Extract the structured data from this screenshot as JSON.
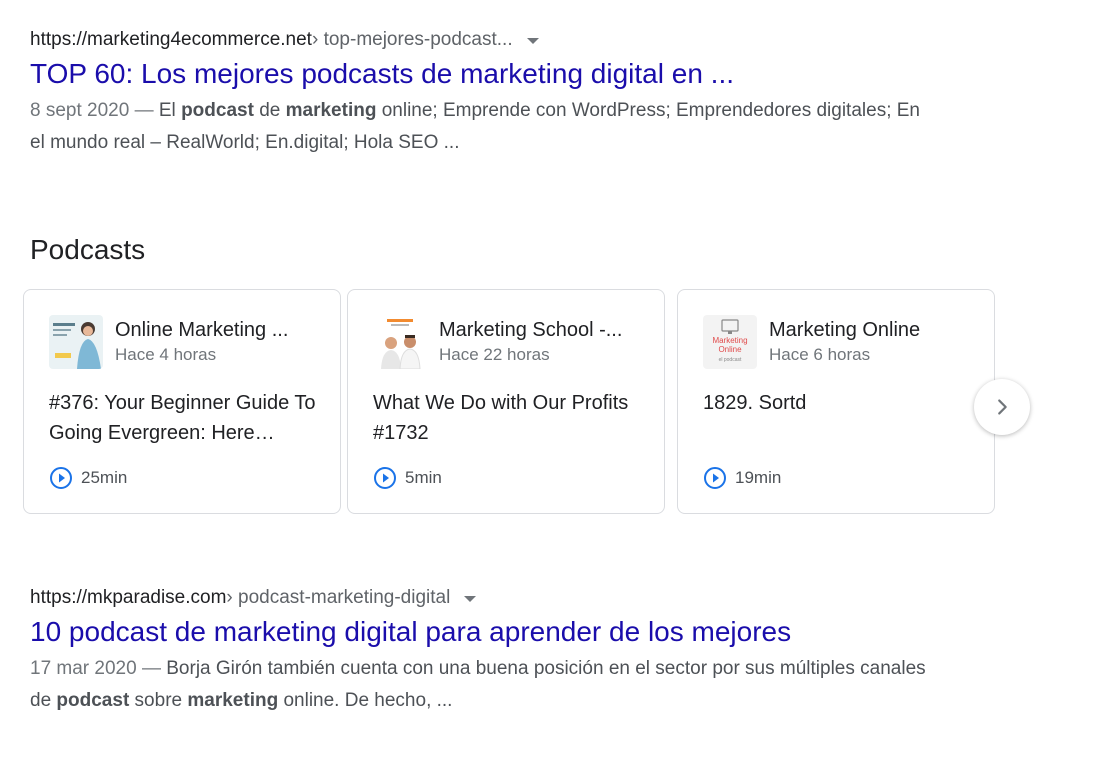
{
  "results": [
    {
      "cite_domain": "https://marketing4ecommerce.net",
      "cite_path": " › top-mejores-podcast...",
      "title": "TOP 60: Los mejores podcasts de marketing digital en ...",
      "date": "8 sept 2020 — ",
      "snippet_parts": [
        "El ",
        "podcast",
        " de ",
        "marketing",
        " online; Emprende con WordPress; Emprendedores digitales; En el mundo real – RealWorld; En.digital; Hola SEO ..."
      ]
    },
    {
      "cite_domain": "https://mkparadise.com",
      "cite_path": " › podcast-marketing-digital",
      "title": "10 podcast de marketing digital para aprender de los mejores",
      "date": "17 mar 2020 — ",
      "snippet_parts": [
        "Borja Girón también cuenta con una buena posición en el sector por sus múltiples canales de ",
        "podcast",
        " sobre ",
        "marketing",
        " online. De hecho, ..."
      ]
    }
  ],
  "podcasts": {
    "section_title": "Podcasts",
    "cards": [
      {
        "show": "Online Marketing ...",
        "time": "Hace 4 horas",
        "episode": "#376: Your Beginner Guide To Going Evergreen: Here…",
        "duration": "25min"
      },
      {
        "show": "Marketing School -...",
        "time": "Hace 22 horas",
        "episode": "What We Do with Our Profits #1732",
        "duration": "5min"
      },
      {
        "show": "Marketing Online",
        "time": "Hace 6 horas",
        "episode": "1829. Sortd",
        "duration": "19min"
      }
    ],
    "thumb3_text": [
      "Marketing",
      "Online",
      "el podcast"
    ]
  },
  "icons": {
    "play": "play-circle-icon",
    "next": "chevron-right-icon",
    "caret": "caret-down-icon"
  },
  "colors": {
    "link": "#1a0dab",
    "accent_blue": "#1a73e8"
  }
}
